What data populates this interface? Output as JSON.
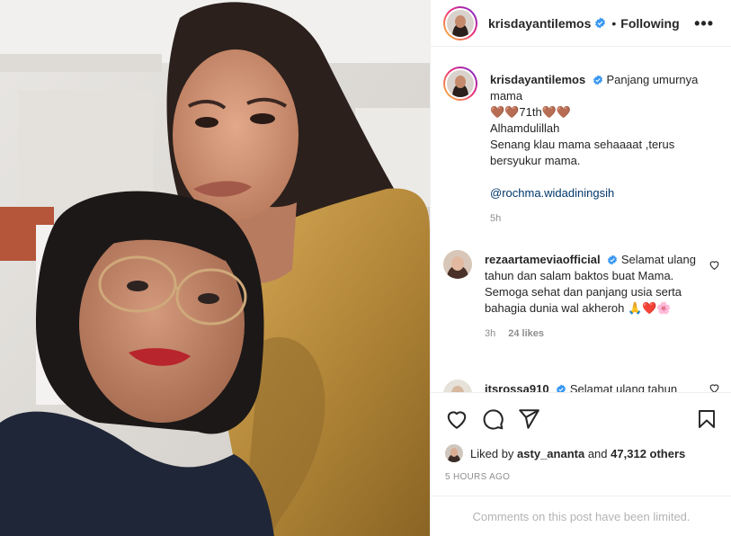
{
  "header": {
    "username": "krisdayantilemos",
    "separator": "•",
    "follow_status": "Following",
    "more_label": "•••"
  },
  "caption": {
    "username": "krisdayantilemos",
    "line1": "Panjang umurnya mama",
    "line2": "🤎🤎71th🤎🤎",
    "line3": "Alhamdulillah",
    "line4": "Senang klau mama sehaaaat ,terus bersyukur mama.",
    "mention": "@rochma.widadiningsih",
    "time": "5h"
  },
  "comment1": {
    "username": "rezaartameviaofficial",
    "text": "Selamat ulang tahun dan salam baktos buat Mama. Semoga sehat dan panjang usia serta bahagia dunia wal akheroh 🙏❤️🌸",
    "time": "3h",
    "likes": "24 likes"
  },
  "comment2": {
    "username": "itsrossa910",
    "text": "Selamat ulang tahun"
  },
  "likes": {
    "prefix": "Liked by",
    "first_user": "asty_ananta",
    "middle": "and",
    "count": "47,312 others"
  },
  "timestamp": "5 HOURS AGO",
  "comments_limited": "Comments on this post have been limited.",
  "icons": [
    "verified-icon",
    "heart-icon",
    "comment-icon",
    "share-icon",
    "bookmark-icon",
    "more-icon"
  ],
  "colors": {
    "verified": "#3897f0",
    "mention": "#00376b",
    "muted": "#8e8e8e",
    "photo_dress": "#b5893a"
  }
}
